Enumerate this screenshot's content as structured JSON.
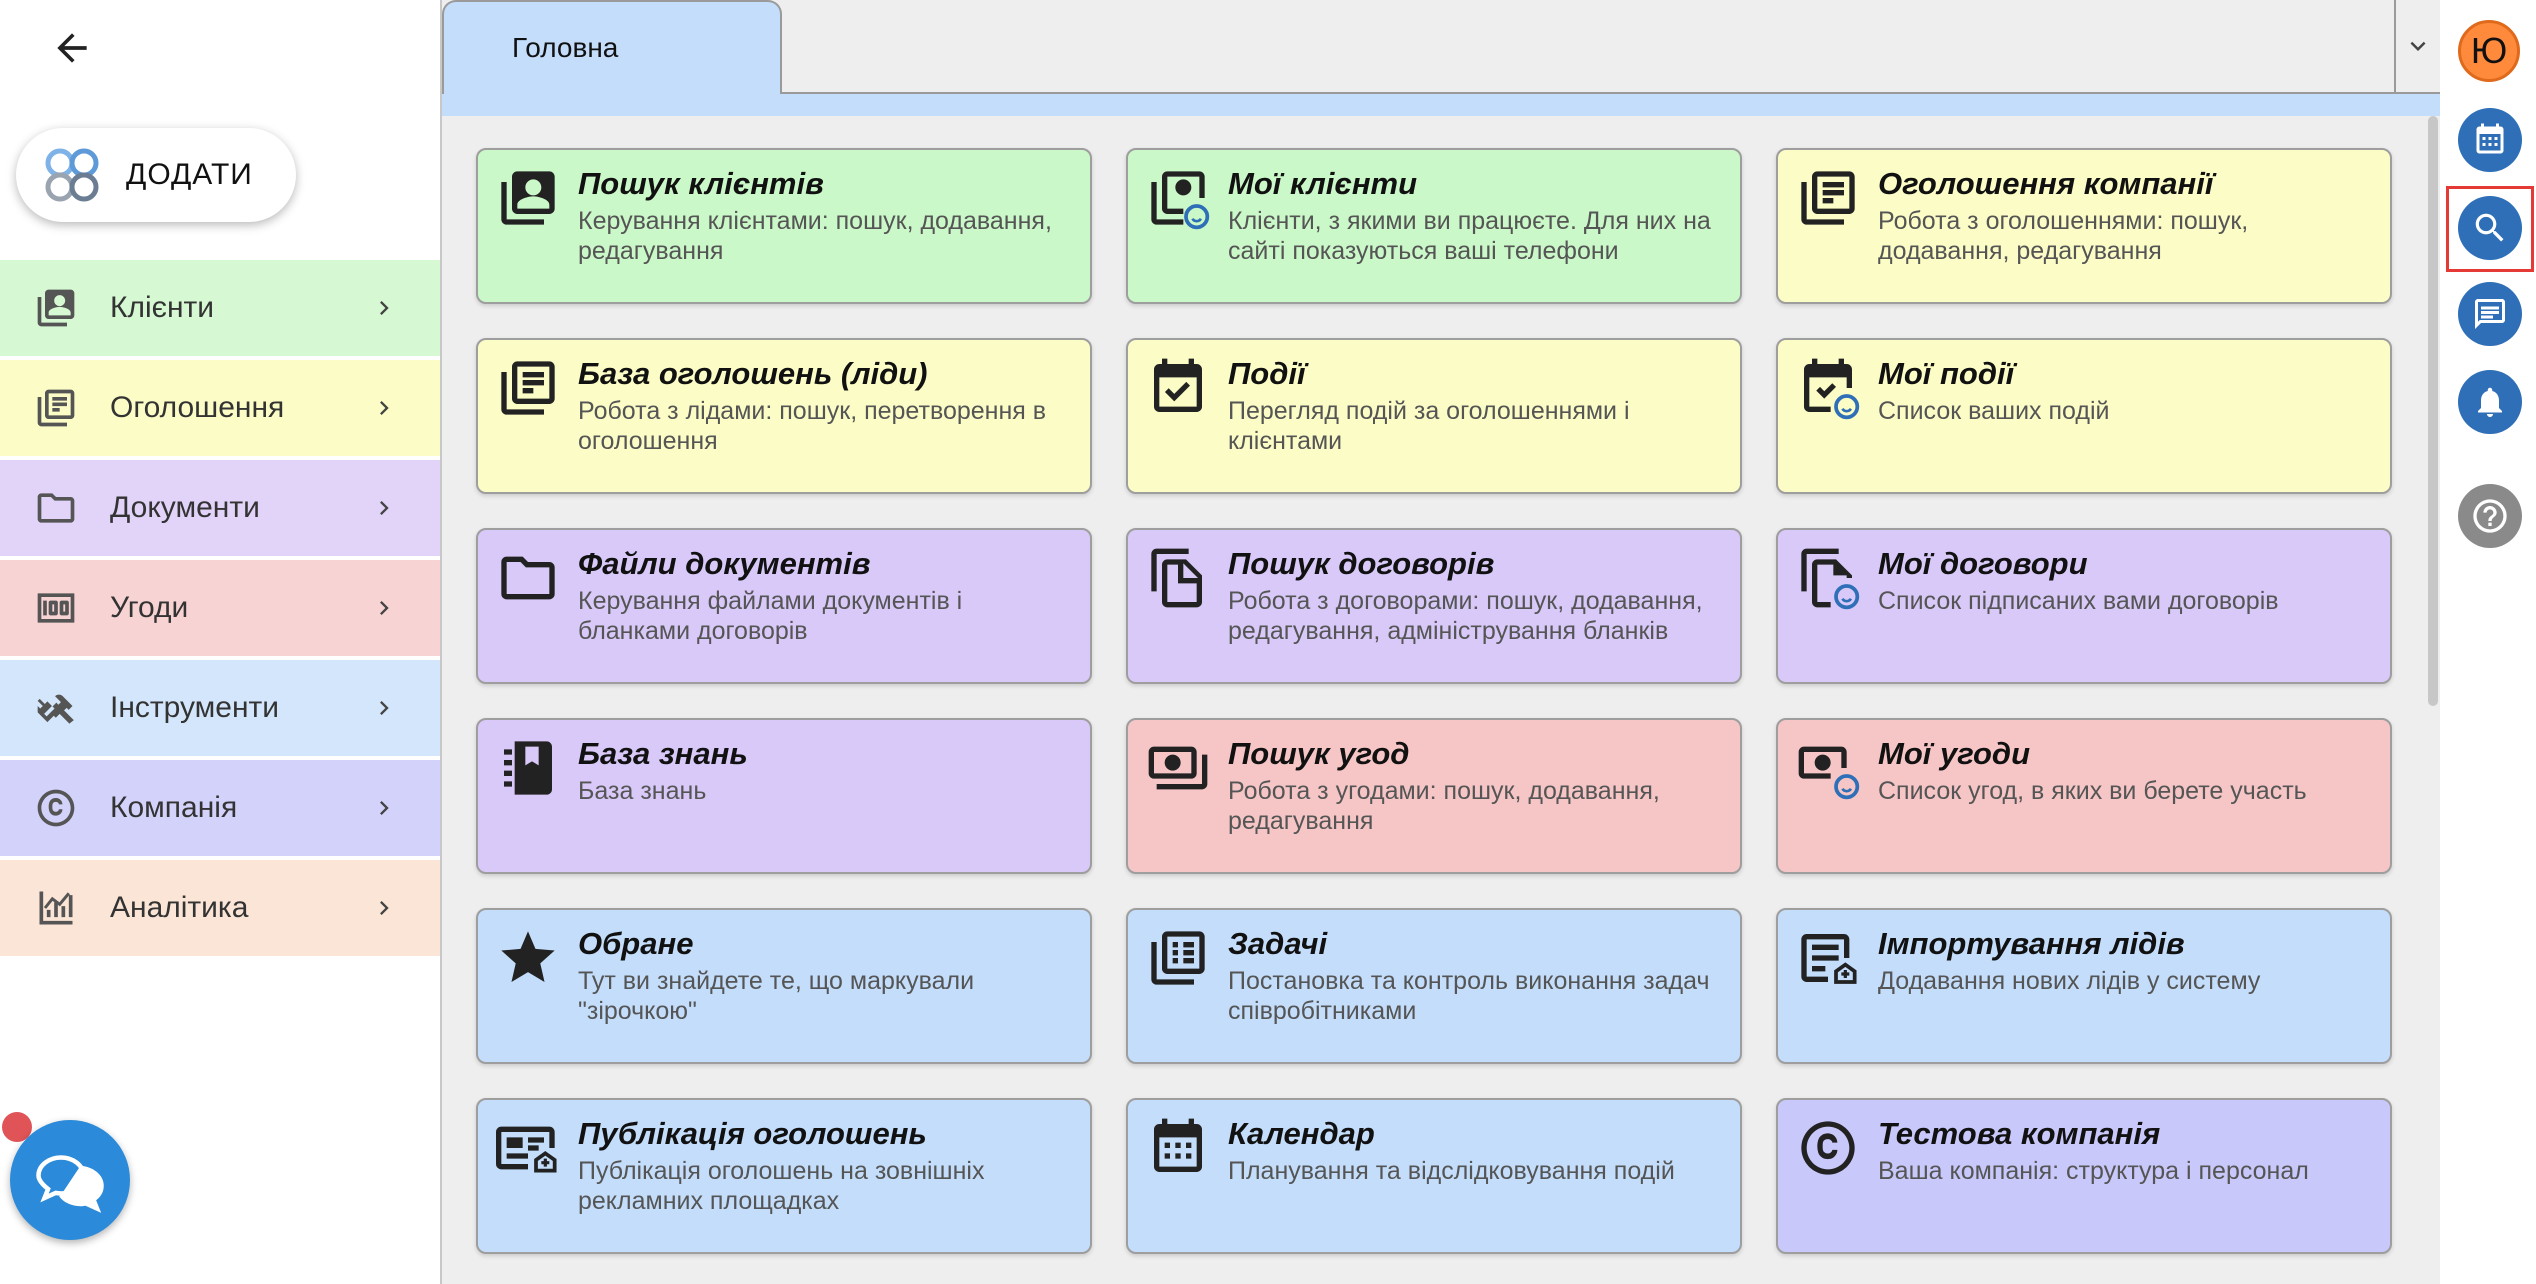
{
  "sidebar": {
    "add_label": "ДОДАТИ",
    "items": [
      {
        "label": "Клієнти",
        "color": "#d6f8d2"
      },
      {
        "label": "Оголошення",
        "color": "#fcfdc6"
      },
      {
        "label": "Документи",
        "color": "#e2d3f9"
      },
      {
        "label": "Угоди",
        "color": "#f7d3d3"
      },
      {
        "label": "Інструменти",
        "color": "#d4e6fb"
      },
      {
        "label": "Компанія",
        "color": "#d2d2fb"
      },
      {
        "label": "Аналітика",
        "color": "#fbe5d6"
      }
    ]
  },
  "tabs": [
    {
      "label": "Головна"
    }
  ],
  "cards": [
    {
      "title": "Пошук клієнтів",
      "desc": "Керування клієнтами: пошук, додавання, редагування"
    },
    {
      "title": "Мої клієнти",
      "desc": "Клієнти, з якими ви працюєте. Для них на сайті показуються ваші телефони"
    },
    {
      "title": "Оголошення компанії",
      "desc": "Робота з оголошеннями: пошук, додавання, редагування"
    },
    {
      "title": "База оголошень (ліди)",
      "desc": "Робота з лідами: пошук, перетворення в оголошення"
    },
    {
      "title": "Події",
      "desc": "Перегляд подій за оголошеннями і клієнтами"
    },
    {
      "title": "Мої події",
      "desc": "Список ваших подій"
    },
    {
      "title": "Файли документів",
      "desc": "Керування файлами документів і бланками договорів"
    },
    {
      "title": "Пошук договорів",
      "desc": "Робота з договорами: пошук, додавання, редагування, адміністрування бланків"
    },
    {
      "title": "Мої договори",
      "desc": "Список підписаних вами договорів"
    },
    {
      "title": "База знань",
      "desc": "База знань"
    },
    {
      "title": "Пошук угод",
      "desc": "Робота з угодами: пошук, додавання, редагування"
    },
    {
      "title": "Мої угоди",
      "desc": "Список угод, в яких ви берете участь"
    },
    {
      "title": "Обране",
      "desc": "Тут ви знайдете те, що маркували \"зірочкою\""
    },
    {
      "title": "Задачі",
      "desc": "Постановка та контроль виконання задач співробітниками"
    },
    {
      "title": "Імпортування лідів",
      "desc": "Додавання нових лідів у систему"
    },
    {
      "title": "Публікація оголошень",
      "desc": "Публікація оголошень на зовнішніх рекламних площадках"
    },
    {
      "title": "Календар",
      "desc": "Планування та відслідковування подій"
    },
    {
      "title": "Тестова компанія",
      "desc": "Ваша компанія: структура і персонал"
    }
  ],
  "right_rail": {
    "avatar_initial": "Ю",
    "accent": "#2e6fb7"
  }
}
